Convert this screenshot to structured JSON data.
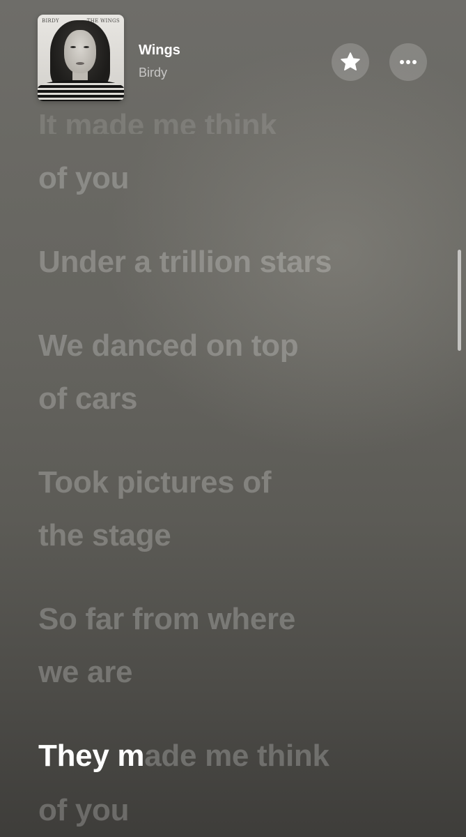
{
  "now_playing": {
    "title": "Wings",
    "artist": "Birdy",
    "artwork": {
      "label_left": "BIRDY",
      "label_right": "THE WINGS"
    }
  },
  "actions": {
    "favorite_icon": "star-icon",
    "more_icon": "ellipsis-icon"
  },
  "lyrics": {
    "line_1": "It made me think",
    "line_2": "of you",
    "line_3": "Under a trillion stars",
    "line_4": "We danced on top",
    "line_5": "of cars",
    "line_6": "Took pictures of",
    "line_7": "the stage",
    "line_8": "So far from where",
    "line_9": "we are",
    "current_sung": "They m",
    "current_rest": "ade me think",
    "line_11": "of you"
  },
  "colors": {
    "active_lyric": "#ffffff",
    "inactive_lyric": "rgba(255,255,255,0.23)"
  }
}
